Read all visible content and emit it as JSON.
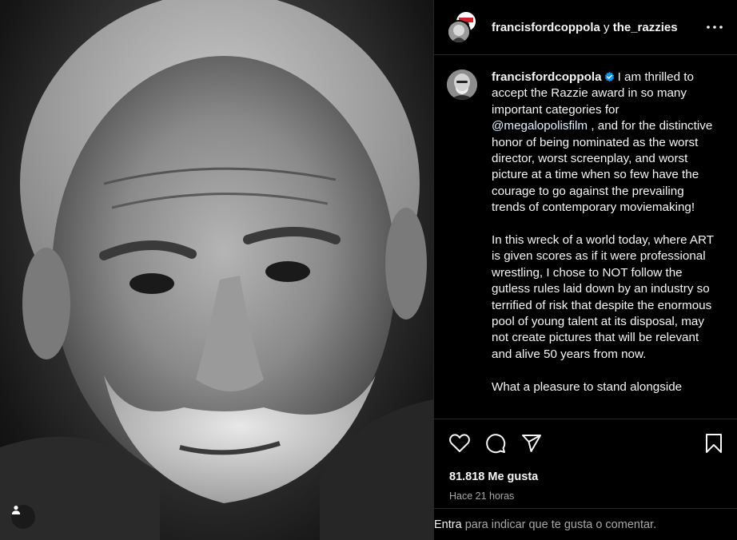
{
  "post": {
    "author": "francisfordcoppola",
    "header_conjunction": "y",
    "collaborator": "the_razzies",
    "caption_paragraph_1_before": "I am thrilled to accept the Razzie award in so many important categories for",
    "mention": "@megalopolisfilm",
    "caption_paragraph_1_after": ", and for the distinctive honor of being nominated as the worst director, worst screenplay, and worst picture at a time when so few have the courage to go against the prevailing trends of contemporary moviemaking!",
    "caption_paragraph_2": "In this wreck of a world today, where ART is given scores as if it were professional wrestling, I chose to NOT follow the gutless rules laid down by an industry so terrified of risk that despite the enormous pool of young talent at its disposal, may not create pictures that will be relevant and alive 50 years from now.",
    "caption_paragraph_3_partial": "What a pleasure to stand alongside"
  },
  "stats": {
    "likes_text": "81.818 Me gusta",
    "time_ago": "Hace 21 horas"
  },
  "login_prompt": {
    "link": "Entra",
    "text": " para indicar que te gusta o comentar."
  },
  "icons": {
    "more": "more-horizontal-icon",
    "like": "heart-icon",
    "comment": "comment-icon",
    "share": "paper-plane-icon",
    "save": "bookmark-icon",
    "tagged_users": "user-tag-icon",
    "verified": "verified-badge-icon"
  },
  "colors": {
    "background": "#000000",
    "divider": "#262626",
    "text": "#f5f5f5",
    "secondary_text": "#a8a8a8",
    "verified_blue": "#0095f6",
    "mention": "#e0f1ff"
  }
}
